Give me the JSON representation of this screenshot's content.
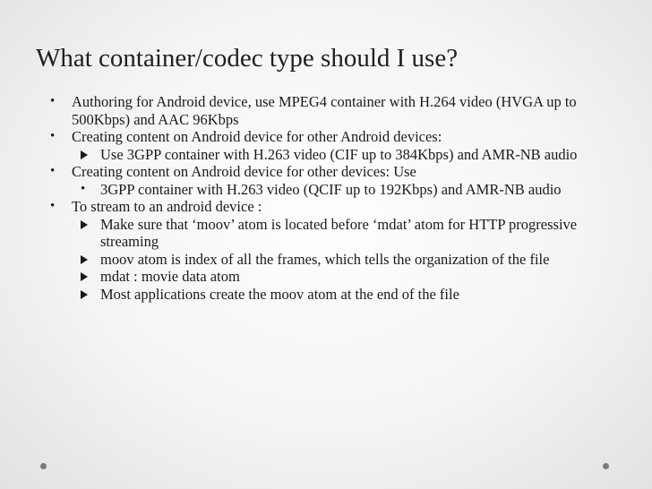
{
  "slide": {
    "title": "What container/codec type should I use?",
    "bullets": [
      {
        "text": "Authoring for Android device, use MPEG4 container with H.264 video (HVGA up to 500Kbps) and AAC 96Kbps",
        "sub": []
      },
      {
        "text": "Creating content on Android device for other Android devices:",
        "sub": [
          "Use 3GPP container with H.263 video (CIF up to 384Kbps) and AMR-NB audio"
        ]
      },
      {
        "text": "Creating content on Android device for other devices: Use",
        "sub": [
          "3GPP container with H.263 video (QCIF up to 192Kbps) and AMR-NB audio"
        ]
      },
      {
        "text": "To stream to an android device :",
        "sub": [
          "Make sure that ‘moov’ atom is located before ‘mdat’ atom for HTTP progressive streaming",
          "moov atom is index of all the frames, which tells the organization of the file",
          "mdat : movie data atom",
          "Most applications create the moov atom at the end of the file"
        ]
      }
    ]
  }
}
